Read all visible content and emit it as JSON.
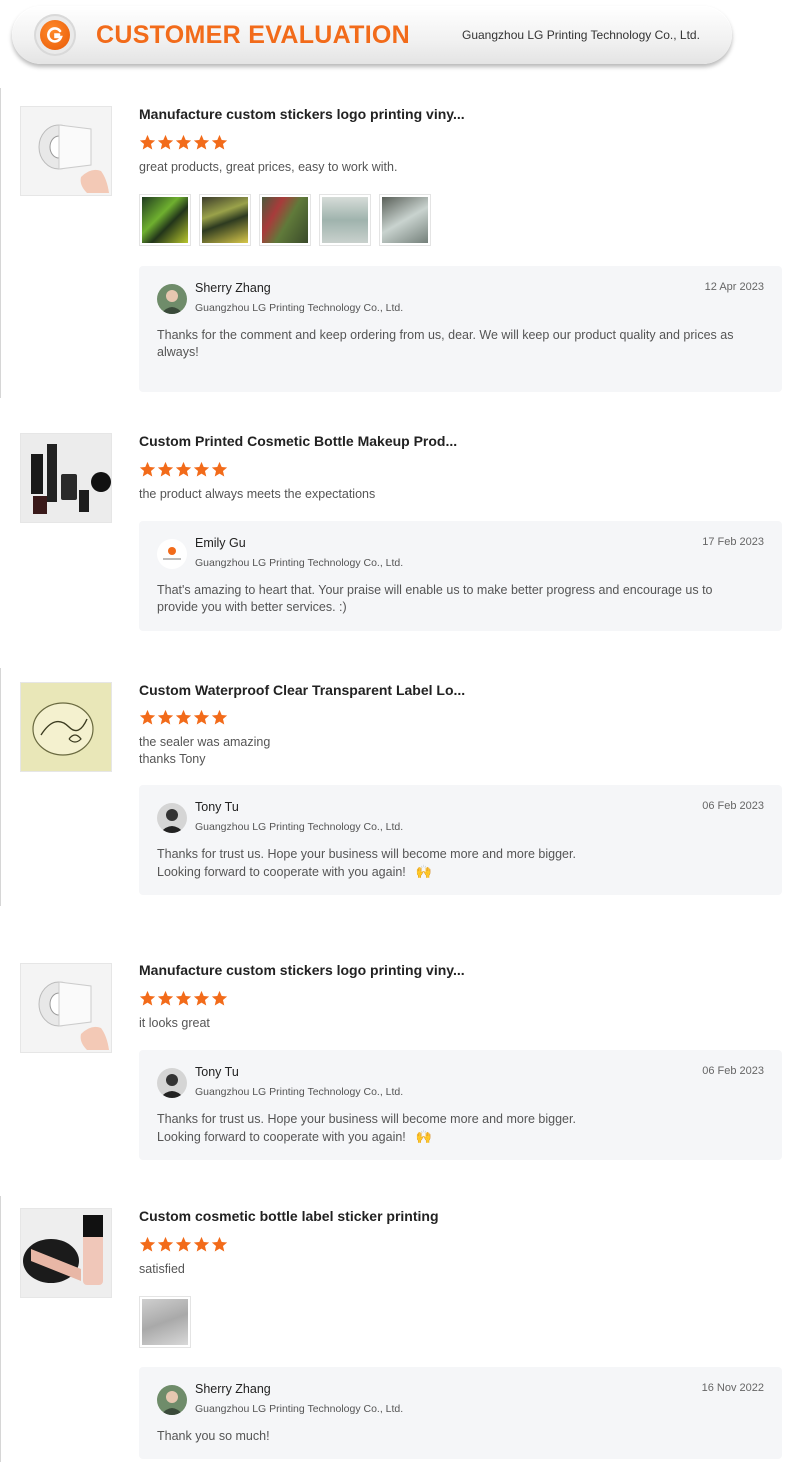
{
  "header": {
    "title": "CUSTOMER EVALUATION",
    "company": "Guangzhou LG Printing Technology Co., Ltd.",
    "accent": "#f26b1a"
  },
  "star_color": "#f26b1a",
  "reviews": [
    {
      "product": "Manufacture custom stickers logo printing viny...",
      "rating": 5,
      "text": "great products, great prices, easy to work with.",
      "photo_count": 5,
      "reply": {
        "name": "Sherry Zhang",
        "company": "Guangzhou LG Printing Technology Co., Ltd.",
        "date": "12 Apr 2023",
        "message": "Thanks for the comment and keep ordering from us, dear.  We will keep our product quality and prices as\nalways!"
      }
    },
    {
      "product": "Custom Printed Cosmetic Bottle Makeup Prod...",
      "rating": 5,
      "text": "the product always meets the expectations",
      "photo_count": 0,
      "reply": {
        "name": "Emily Gu",
        "company": "Guangzhou LG Printing Technology Co., Ltd.",
        "date": "17 Feb 2023",
        "message": "That's amazing to heart that. Your praise will enable us to make better progress and encourage us to\nprovide you with better services. :)"
      }
    },
    {
      "product": "Custom Waterproof Clear Transparent Label Lo...",
      "rating": 5,
      "text": "the sealer was amazing\nthanks Tony",
      "photo_count": 0,
      "reply": {
        "name": "Tony Tu",
        "company": "Guangzhou LG Printing Technology Co., Ltd.",
        "date": "06 Feb 2023",
        "message": "Thanks for trust us. Hope your business will become more and more bigger.\nLooking forward to cooperate with you again!",
        "emoji": "🙌"
      }
    },
    {
      "product": "Manufacture custom stickers logo printing viny...",
      "rating": 5,
      "text": "it looks great",
      "photo_count": 0,
      "reply": {
        "name": "Tony Tu",
        "company": "Guangzhou LG Printing Technology Co., Ltd.",
        "date": "06 Feb 2023",
        "message": "Thanks for trust us. Hope your business will become more and more bigger.\nLooking forward to cooperate with you again!",
        "emoji": "🙌"
      }
    },
    {
      "product": "Custom cosmetic bottle label sticker printing",
      "rating": 5,
      "text": "satisfied",
      "photo_count": 1,
      "reply": {
        "name": "Sherry Zhang",
        "company": "Guangzhou LG Printing Technology Co., Ltd.",
        "date": "16 Nov 2022",
        "message": "Thank you so much!"
      }
    }
  ]
}
